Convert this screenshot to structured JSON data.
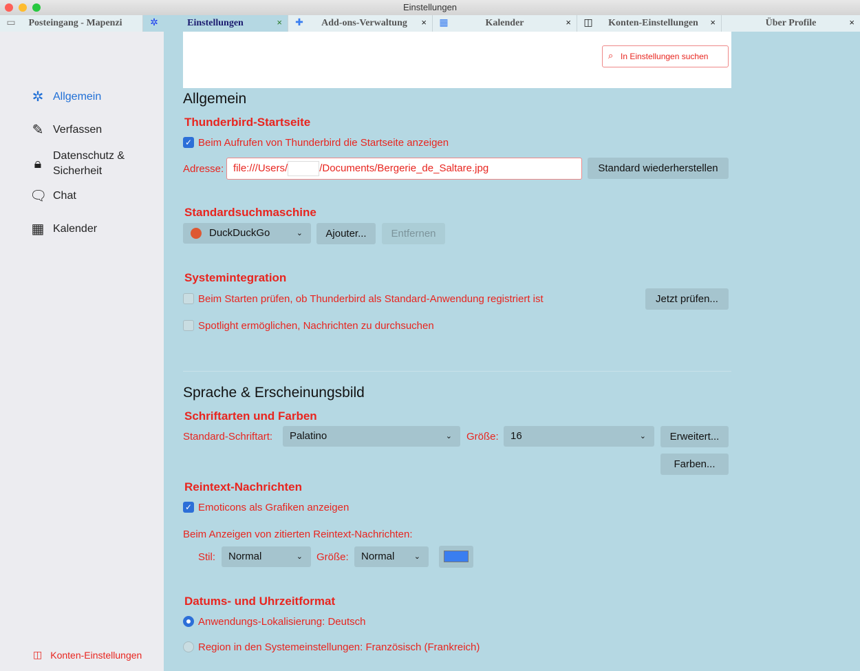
{
  "window": {
    "title": "Einstellungen"
  },
  "tabs": [
    {
      "label": "Posteingang - Mapenzi",
      "icon": "inbox-icon",
      "closable": false
    },
    {
      "label": "Einstellungen",
      "icon": "gear-icon",
      "closable": true,
      "active": true
    },
    {
      "label": "Add-ons-Verwaltung",
      "icon": "puzzle-icon",
      "closable": true
    },
    {
      "label": "Kalender",
      "icon": "calendar-icon",
      "closable": true
    },
    {
      "label": "Konten-Einstellungen",
      "icon": "account-icon",
      "closable": true
    },
    {
      "label": "Über Profile",
      "closable": true
    }
  ],
  "tab_close": "×",
  "sidebar": {
    "items": [
      {
        "label": "Allgemein",
        "icon": "gear-icon"
      },
      {
        "label": "Verfassen",
        "icon": "pencil-icon"
      },
      {
        "label": "Datenschutz &",
        "label2": "Sicherheit",
        "icon": "lock-icon"
      },
      {
        "label": "Chat",
        "icon": "chat-icon"
      },
      {
        "label": "Kalender",
        "icon": "calendar-icon"
      }
    ],
    "account_settings": "Konten-Einstellungen"
  },
  "search": {
    "placeholder": "In Einstellungen suchen"
  },
  "general": {
    "title": "Allgemein",
    "startpage": {
      "heading": "Thunderbird-Startseite",
      "checkbox": "Beim Aufrufen von Thunderbird die Startseite anzeigen",
      "checked": true,
      "address_label": "Adresse:",
      "address_prefix": "file:///Users/",
      "address_suffix": "/Documents/Bergerie_de_Saltare.jpg",
      "restore_button": "Standard wiederherstellen"
    },
    "search_engine": {
      "heading": "Standardsuchmaschine",
      "selected": "DuckDuckGo",
      "add_button": "Ajouter...",
      "remove_button": "Entfernen"
    },
    "system": {
      "heading": "Systemintegration",
      "check_default": "Beim Starten prüfen, ob Thunderbird als Standard-Anwendung registriert ist",
      "check_now_button": "Jetzt prüfen...",
      "spotlight": "Spotlight ermöglichen, Nachrichten zu durchsuchen"
    }
  },
  "appearance": {
    "title": "Sprache & Erscheinungsbild",
    "fonts": {
      "heading": "Schriftarten und Farben",
      "font_label": "Standard-Schriftart:",
      "font_value": "Palatino",
      "size_label": "Größe:",
      "size_value": "16",
      "advanced_button": "Erweitert...",
      "colors_button": "Farben..."
    },
    "plaintext": {
      "heading": "Reintext-Nachrichten",
      "emoticons": "Emoticons als Grafiken anzeigen",
      "emoticons_checked": true,
      "quoted_label": "Beim Anzeigen von zitierten Reintext-Nachrichten:",
      "style_label": "Stil:",
      "style_value": "Normal",
      "size_label": "Größe:",
      "size_value": "Normal",
      "quote_color": "#3a7ef0"
    },
    "datetime": {
      "heading": "Datums- und Uhrzeitformat",
      "option1": "Anwendungs-Lokalisierung: Deutsch",
      "option2": "Region in den Systemeinstellungen: Französisch (Frankreich)",
      "selected": 1
    }
  }
}
